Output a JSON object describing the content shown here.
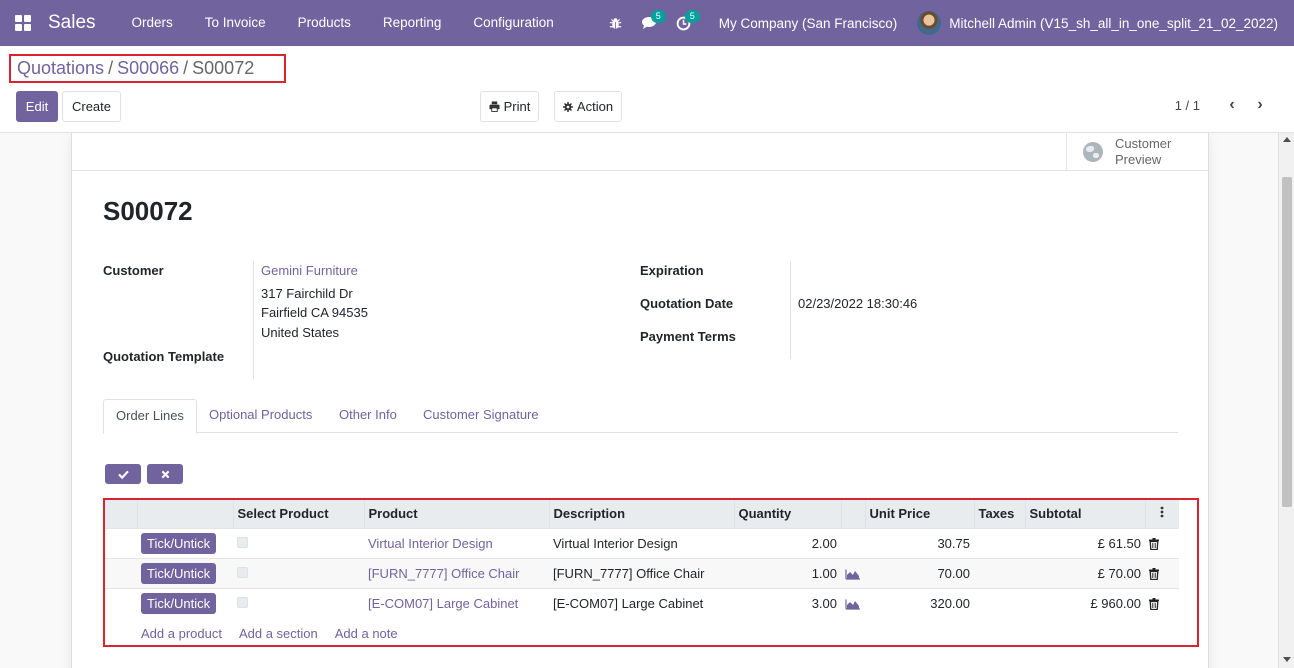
{
  "colors": {
    "brand": "#71639e",
    "highlight_border": "#d9232d",
    "badge": "#00a09d"
  },
  "navbar": {
    "app_name": "Sales",
    "menu": [
      "Orders",
      "To Invoice",
      "Products",
      "Reporting",
      "Configuration"
    ],
    "messages_badge": "5",
    "activities_badge": "5",
    "company": "My Company (San Francisco)",
    "user": "Mitchell Admin (V15_sh_all_in_one_split_21_02_2022)"
  },
  "breadcrumb": {
    "items": [
      "Quotations",
      "S00066"
    ],
    "current": "S00072",
    "separator": "/"
  },
  "toolbar": {
    "edit": "Edit",
    "create": "Create",
    "print": "Print",
    "action": "Action"
  },
  "pager": {
    "value": "1 / 1"
  },
  "stat_button": {
    "line1": "Customer",
    "line2": "Preview"
  },
  "record": {
    "name": "S00072",
    "customer_label": "Customer",
    "customer_name": "Gemini Furniture",
    "address": [
      "317 Fairchild Dr",
      "Fairfield CA 94535",
      "United States"
    ],
    "template_label": "Quotation Template",
    "expiration_label": "Expiration",
    "quotation_date_label": "Quotation Date",
    "quotation_date": "02/23/2022 18:30:46",
    "payment_terms_label": "Payment Terms"
  },
  "tabs": [
    "Order Lines",
    "Optional Products",
    "Other Info",
    "Customer Signature"
  ],
  "table": {
    "columns": [
      "Select Product",
      "Product",
      "Description",
      "Quantity",
      "Unit Price",
      "Taxes",
      "Subtotal"
    ],
    "rows": [
      {
        "button": "Tick/Untick",
        "product": "Virtual Interior Design",
        "description": "Virtual Interior Design",
        "quantity": "2.00",
        "unit_price": "30.75",
        "taxes": "",
        "subtotal": "£ 61.50",
        "forecast": false
      },
      {
        "button": "Tick/Untick",
        "product": "[FURN_7777] Office Chair",
        "description": "[FURN_7777] Office Chair",
        "quantity": "1.00",
        "unit_price": "70.00",
        "taxes": "",
        "subtotal": "£ 70.00",
        "forecast": true
      },
      {
        "button": "Tick/Untick",
        "product": "[E-COM07] Large Cabinet",
        "description": "[E-COM07] Large Cabinet",
        "quantity": "3.00",
        "unit_price": "320.00",
        "taxes": "",
        "subtotal": "£ 960.00",
        "forecast": true
      }
    ],
    "add_links": [
      "Add a product",
      "Add a section",
      "Add a note"
    ]
  }
}
